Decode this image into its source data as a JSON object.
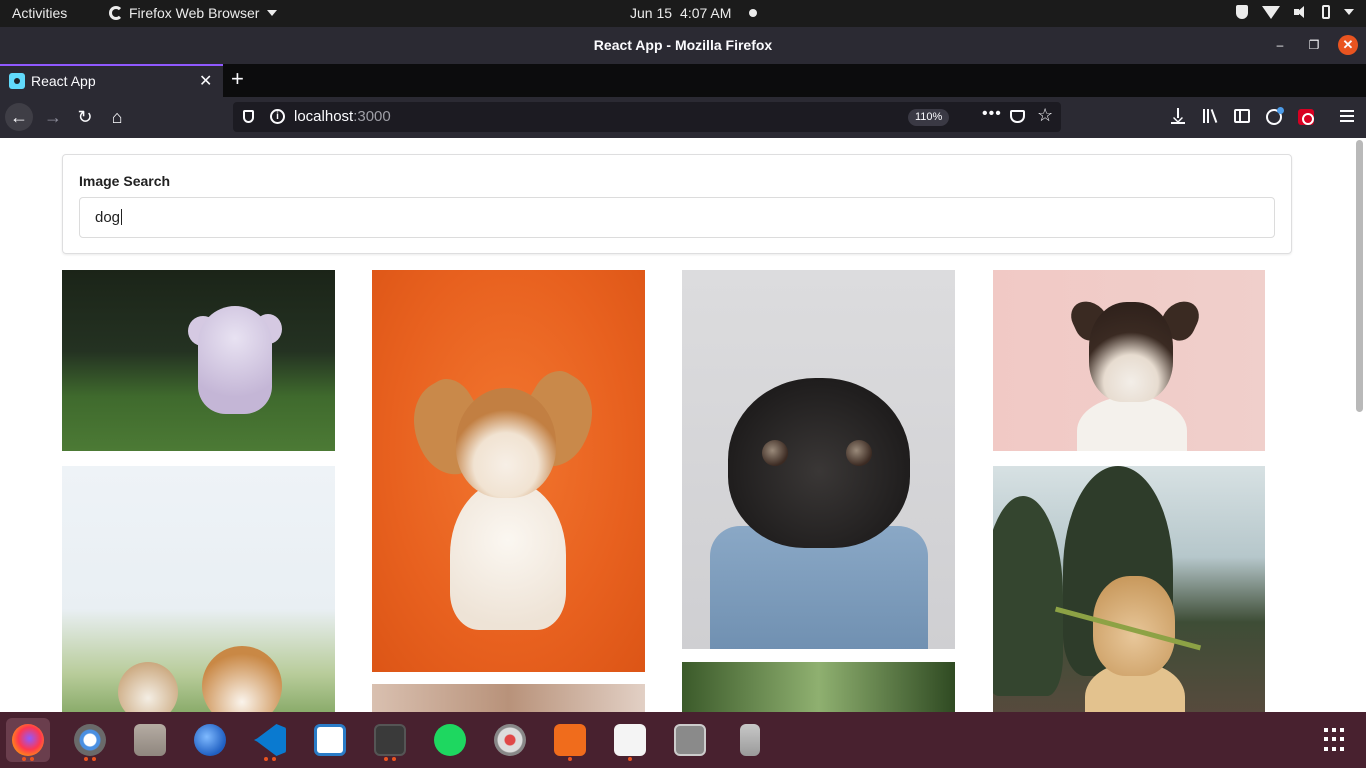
{
  "topbar": {
    "activities": "Activities",
    "app_name": "Firefox Web Browser",
    "date": "Jun 15",
    "time": "4:07 AM"
  },
  "window": {
    "title": "React App - Mozilla Firefox"
  },
  "tabs": [
    {
      "title": "React App",
      "active": true
    }
  ],
  "urlbar": {
    "host": "localhost",
    "port": ":3000",
    "zoom": "110%"
  },
  "page": {
    "search_label": "Image Search",
    "search_value": "dog"
  },
  "images": [
    {
      "name": "fluffy-dog-running"
    },
    {
      "name": "corgi-puppy-orange"
    },
    {
      "name": "pug-denim-jacket"
    },
    {
      "name": "jack-russell-pink"
    },
    {
      "name": "puppies-in-grass"
    },
    {
      "name": "golden-puppy-flower"
    }
  ],
  "dock": {
    "apps": [
      "firefox",
      "chrome",
      "files",
      "thunderbird",
      "vscode",
      "libreoffice-writer",
      "terminal",
      "spotify",
      "rhythmbox",
      "ubuntu-software",
      "text-editor",
      "tablet",
      "usb-drive"
    ]
  },
  "colors": {
    "firefox_dark": "#2b2a33",
    "tab_accent": "#9059ff",
    "dock_bg": "#48212f",
    "ubuntu_orange": "#e95420"
  }
}
